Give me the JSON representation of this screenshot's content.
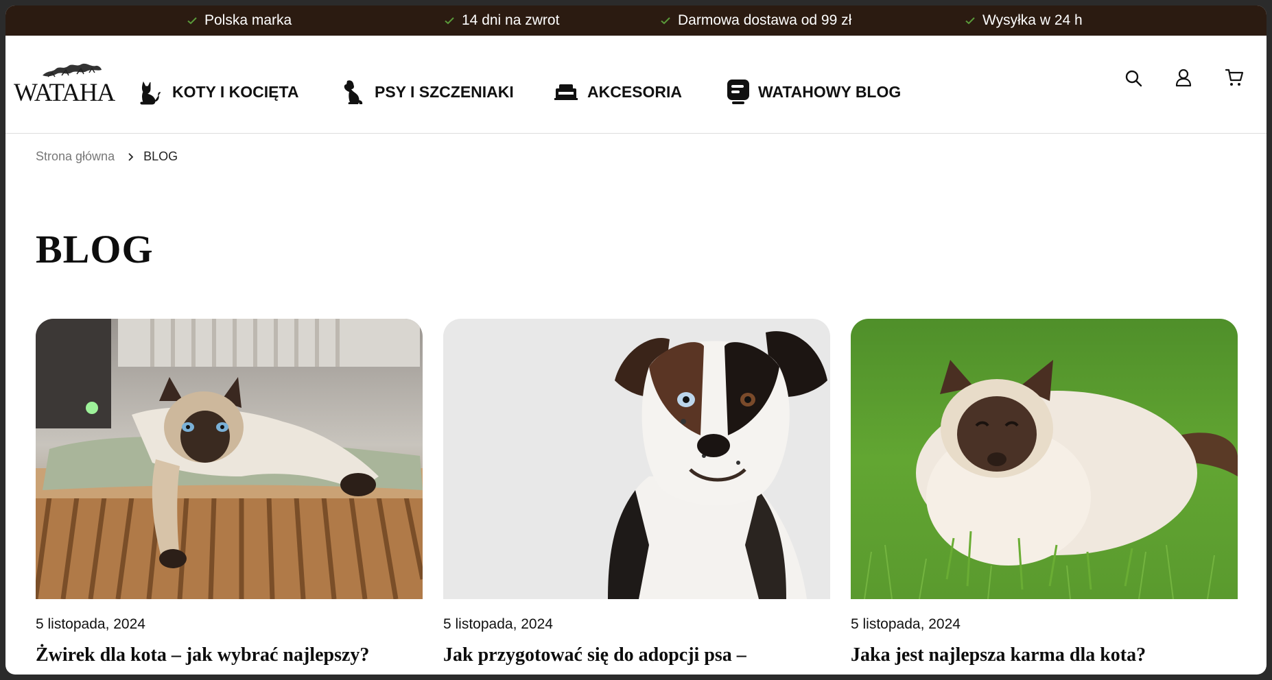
{
  "topbar": {
    "items": [
      {
        "label": "Polska marka"
      },
      {
        "label": "14 dni na zwrot"
      },
      {
        "label": "Darmowa dostawa od 99 zł"
      },
      {
        "label": "Wysyłka w 24 h"
      }
    ],
    "check_color": "#5a9a3a",
    "background": "#2b1b11"
  },
  "header": {
    "logo_text": "WATAHA",
    "nav": [
      {
        "label": "KOTY I KOCIĘTA",
        "icon": "cat-icon"
      },
      {
        "label": "PSY I SZCZENIAKI",
        "icon": "dog-icon"
      },
      {
        "label": "AKCESORIA",
        "icon": "pet-bed-icon"
      },
      {
        "label": "WATAHOWY BLOG",
        "icon": "blog-icon"
      }
    ],
    "actions": [
      "search-icon",
      "user-icon",
      "cart-icon"
    ]
  },
  "breadcrumb": {
    "home": "Strona główna",
    "current": "BLOG"
  },
  "page": {
    "title": "BLOG"
  },
  "posts": [
    {
      "date": "5 listopada, 2024",
      "title": "Żwirek dla kota – jak wybrać najlepszy?"
    },
    {
      "date": "5 listopada, 2024",
      "title": "Jak przygotować się do adopcji psa –"
    },
    {
      "date": "5 listopada, 2024",
      "title": "Jaka jest najlepsza karma dla kota?"
    }
  ]
}
